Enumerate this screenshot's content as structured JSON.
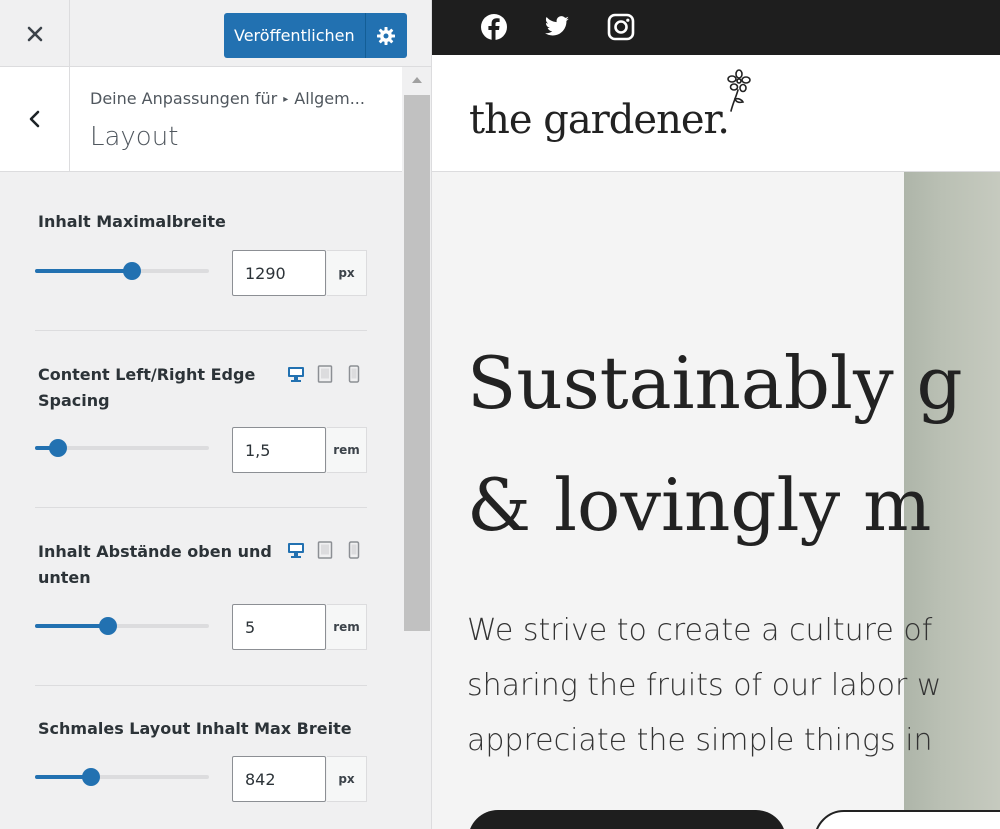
{
  "topbar": {
    "publish_label": "Veröffentlichen"
  },
  "section": {
    "breadcrumb_part1": "Deine Anpassungen für",
    "breadcrumb_part2": "Allgem...",
    "title": "Layout"
  },
  "controls": [
    {
      "label": "Inhalt Maximalbreite",
      "value": "1290",
      "unit": "px",
      "slider_percent": 56
    },
    {
      "label": "Content Left/Right Edge Spacing",
      "value": "1,5",
      "unit": "rem",
      "slider_percent": 13
    },
    {
      "label": "Inhalt Abstände oben und unten",
      "value": "5",
      "unit": "rem",
      "slider_percent": 42
    },
    {
      "label": "Schmales Layout Inhalt Max Breite",
      "value": "842",
      "unit": "px",
      "slider_percent": 32
    }
  ],
  "colors": {
    "accent": "#2271b1",
    "dark": "#1e1e1e",
    "panel_bg": "#f0f0f1"
  },
  "preview": {
    "social_icons": [
      "facebook-icon",
      "twitter-icon",
      "instagram-icon"
    ],
    "logo": "the gardener.",
    "hero_title_line1": "Sustainably g",
    "hero_title_line2": "& lovingly m",
    "hero_text_line1": "We strive to create a culture of",
    "hero_text_line2": "sharing the fruits of our labor w",
    "hero_text_line3": "appreciate the simple things in"
  }
}
